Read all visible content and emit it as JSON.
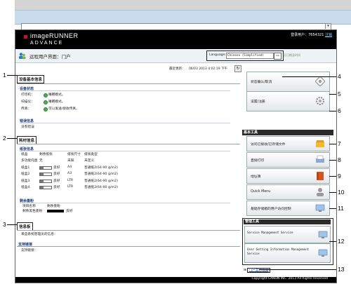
{
  "header": {
    "logo_line1": "imageRUNNER",
    "logo_line2": "ADVANCE",
    "login_label": "登录用户：7654321",
    "logout_label": "注销"
  },
  "subbar": {
    "page_title": "远程用户界面：门户",
    "language_label": "Language:",
    "language_value": "Chinese (Simplified)",
    "lang_go": "⇨",
    "lang_link": "至日期及时间"
  },
  "main": {
    "updated_label": "最近更新：",
    "updated_value": "06/03 2013 4:02:19 下午",
    "refresh_symbol": "↻",
    "device_basic_title": "设备基本信息",
    "device_status_title": "设备状态",
    "device_status": [
      {
        "name": "打印机：",
        "value": "睡眠模式。"
      },
      {
        "name": "扫描仪：",
        "value": "睡眠模式。"
      },
      {
        "name": "传真：",
        "value": "可以发送/接收传真。"
      }
    ],
    "error_title": "错误信息",
    "error_value": "没有错误",
    "consumables_title": "耗材信息",
    "paper_title": "纸张信息",
    "paper_headers": [
      "纸盒",
      "剩余纸张",
      "纸张尺寸",
      "纸张类型"
    ],
    "paper_rows": [
      {
        "tray": "多功能托盘",
        "remain": "无",
        "size": "未知",
        "type": "未定义",
        "bar": false,
        "fill": 0
      },
      {
        "tray": "纸盒1",
        "remain": "良好",
        "size": "A4",
        "type": "普通纸2(64-90 g/m2)",
        "bar": true,
        "fill": 0.3
      },
      {
        "tray": "纸盒2",
        "remain": "良好",
        "size": "A3",
        "type": "普通纸2(64-90 g/m2)",
        "bar": true,
        "fill": 0.3
      },
      {
        "tray": "纸盒3",
        "remain": "良好",
        "size": "LTR",
        "type": "普通纸2(64-90 g/m2)",
        "bar": true,
        "fill": 0.3
      },
      {
        "tray": "纸盒4",
        "remain": "良好",
        "size": "LTR",
        "type": "普通纸2(64-90 g/m2)",
        "bar": true,
        "fill": 0.3
      }
    ],
    "toner_title": "剩余墨粉",
    "toner_headers": [
      "项目名称",
      "剩余墨粉"
    ],
    "toner_row": {
      "name": "剩余黑色墨粉",
      "value": "良好"
    },
    "message_title": "信息板",
    "message_value": "来自系统管理员的信息：",
    "support_title": "支持链接",
    "support_value": "支持链接："
  },
  "right": {
    "status_cancel": "状态确认/取消",
    "settings": "设置/注册",
    "basic_tools_title": "基本工具",
    "access_files": "访问已接收/已存储文件",
    "direct_print": "直接打印",
    "address_book": "地址簿",
    "quick_menu": "Quick Menu",
    "user_access": "基础存储箱的用户访问控制",
    "admin_tools_title": "管理工具",
    "service_mgmt": "Service Management Service",
    "user_setting_mgmt": "User Setting Information Management Service",
    "portal_display": "门户显示设置"
  },
  "footer": {
    "copyright": "Copyright CANON INC. 2013 All Rights Reserved"
  },
  "callouts": [
    "1",
    "2",
    "3",
    "4",
    "5",
    "6",
    "7",
    "8",
    "9",
    "10",
    "11",
    "12",
    "13"
  ],
  "colors": {
    "header_bg": "#000000",
    "section_blue": "#1a3c78",
    "status_green": "#4caf50",
    "chrome_blue": "#c9dced"
  }
}
